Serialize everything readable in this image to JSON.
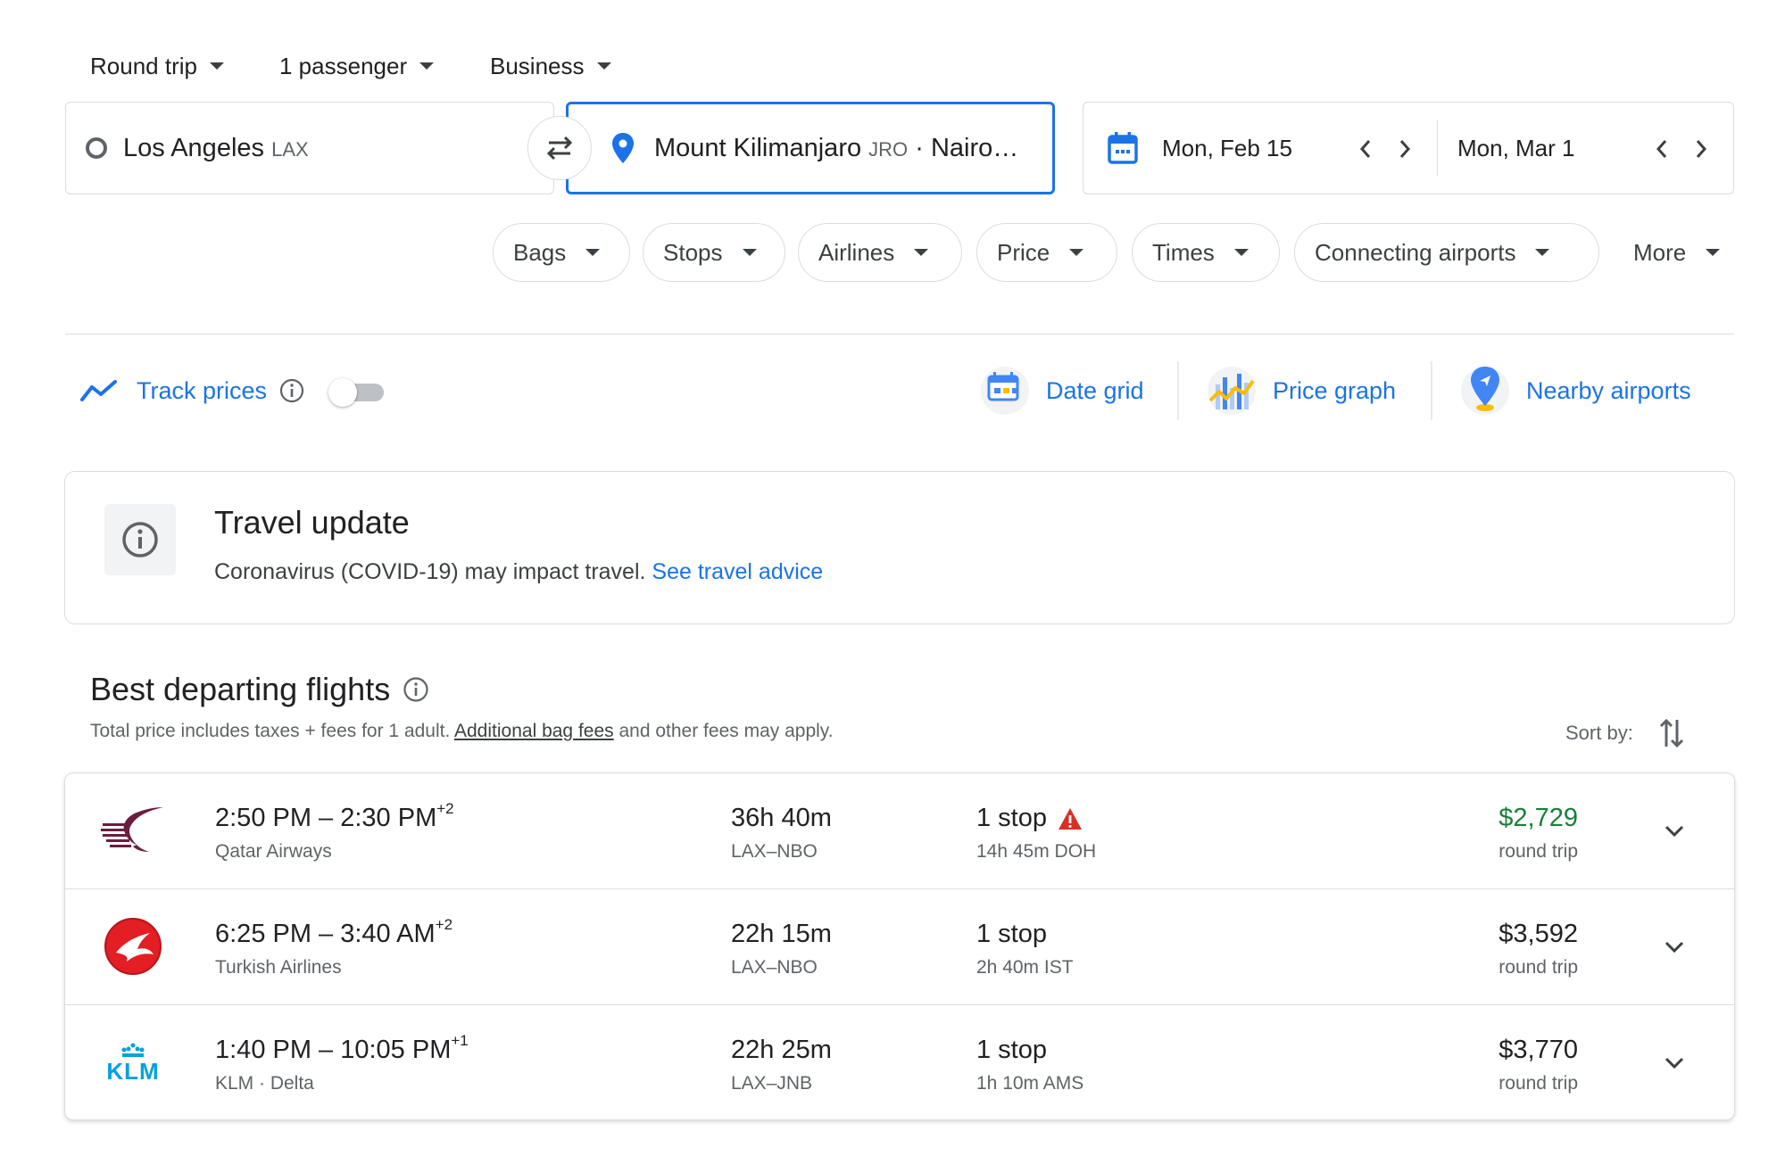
{
  "trip_options": {
    "trip_type": "Round trip",
    "passengers": "1 passenger",
    "cabin": "Business"
  },
  "search": {
    "origin_city": "Los Angeles",
    "origin_code": "LAX",
    "destination_city": "Mount Kilimanjaro",
    "destination_code": "JRO",
    "destination_more": "· Nairo…",
    "depart_date": "Mon, Feb 15",
    "return_date": "Mon, Mar 1"
  },
  "filters": [
    "Bags",
    "Stops",
    "Airlines",
    "Price",
    "Times",
    "Connecting airports"
  ],
  "more_label": "More",
  "tools": {
    "track_prices": "Track prices",
    "track_prices_on": false,
    "date_grid": "Date grid",
    "price_graph": "Price graph",
    "nearby_airports": "Nearby airports"
  },
  "travel_update": {
    "title": "Travel update",
    "text": "Coronavirus (COVID-19) may impact travel.",
    "link": "See travel advice"
  },
  "section": {
    "title": "Best departing flights",
    "sub_before": "Total price includes taxes + fees for 1 adult.",
    "sub_link": "Additional bag fees",
    "sub_after": "and other fees may apply.",
    "sort_label": "Sort by:"
  },
  "flights": [
    {
      "times": "2:50 PM – 2:30 PM",
      "day_offset": "+2",
      "airline": "Qatar Airways",
      "duration": "36h 40m",
      "route": "LAX–NBO",
      "stops": "1 stop",
      "warning": true,
      "layover": "14h 45m DOH",
      "price": "$2,729",
      "price_color": "#188038",
      "price_type": "round trip",
      "logo": "qatar-airways-logo"
    },
    {
      "times": "6:25 PM – 3:40 AM",
      "day_offset": "+2",
      "airline": "Turkish Airlines",
      "duration": "22h 15m",
      "route": "LAX–NBO",
      "stops": "1 stop",
      "warning": false,
      "layover": "2h 40m IST",
      "price": "$3,592",
      "price_color": "#202124",
      "price_type": "round trip",
      "logo": "turkish-airlines-logo"
    },
    {
      "times": "1:40 PM – 10:05 PM",
      "day_offset": "+1",
      "airline": "KLM · Delta",
      "duration": "22h 25m",
      "route": "LAX–JNB",
      "stops": "1 stop",
      "warning": false,
      "layover": "1h 10m AMS",
      "price": "$3,770",
      "price_color": "#202124",
      "price_type": "round trip",
      "logo": "klm-logo",
      "logo_text": "KLM"
    }
  ],
  "colors": {
    "accent": "#1a73e8",
    "border": "#dadce0",
    "price_good": "#188038",
    "warning": "#d93025"
  }
}
